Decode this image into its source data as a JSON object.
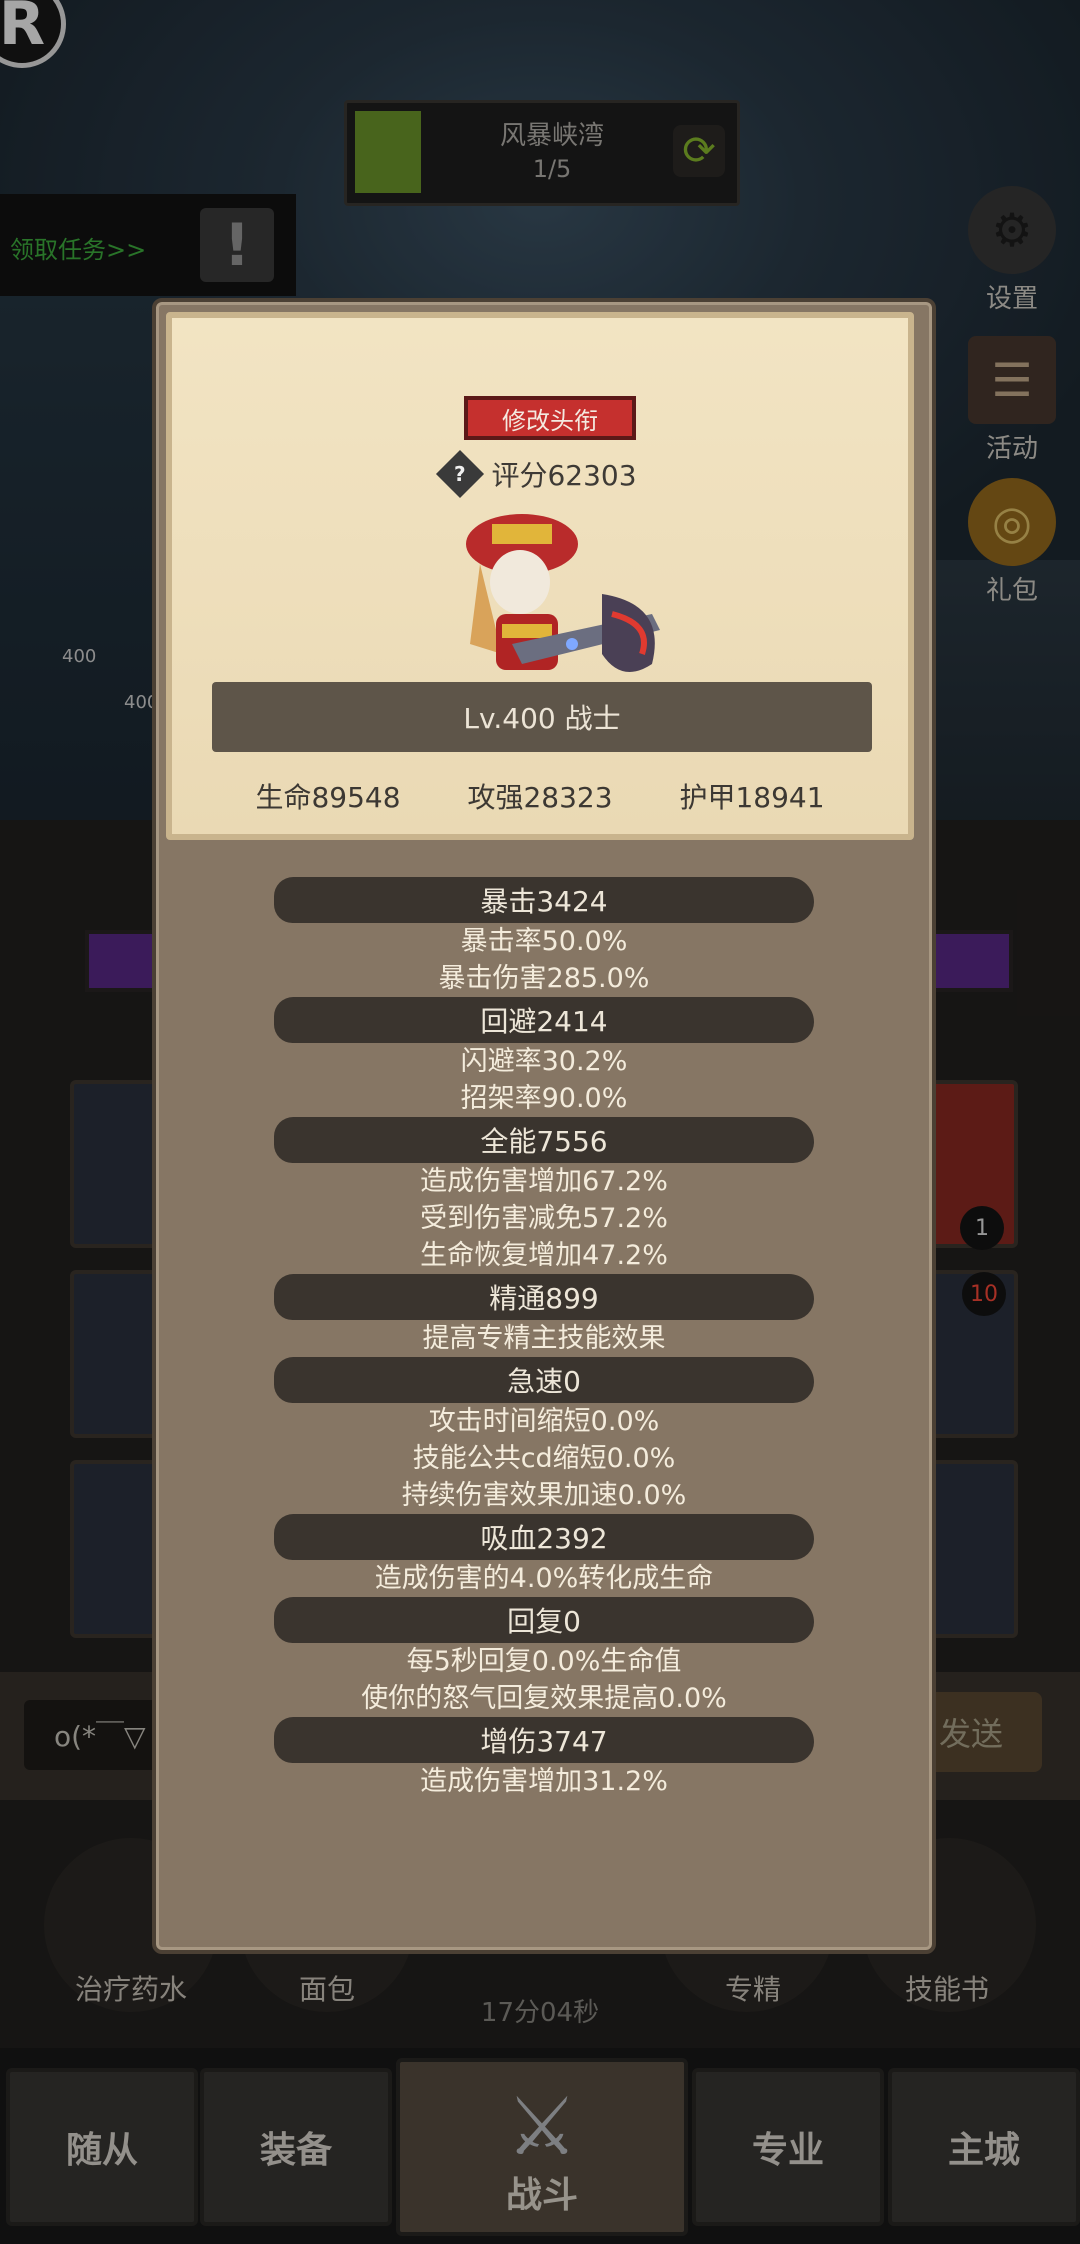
{
  "background": {
    "stage_name": "风暴峡湾",
    "stage_progress": "1/5",
    "task_text": "领取任务>>",
    "side_buttons": [
      {
        "label": "设置",
        "icon": "gear-icon"
      },
      {
        "label": "活动",
        "icon": "scroll-icon"
      },
      {
        "label": "礼包",
        "icon": "gift-icon"
      }
    ],
    "hp_labels": [
      "400",
      "400"
    ],
    "chat_input": "o(*￣▽",
    "send_label": "发送",
    "badges": [
      "1",
      "10"
    ],
    "skills": [
      "治疗药水",
      "面包",
      "专精",
      "技能书"
    ],
    "timer": "17分04秒",
    "nav_tabs": [
      "随从",
      "装备",
      "战斗",
      "专业",
      "主城"
    ]
  },
  "modal": {
    "edit_title_button": "修改头衔",
    "score": "评分62303",
    "level_class": "Lv.400 战士",
    "base_stats": [
      "生命89548",
      "攻强28323",
      "护甲18941"
    ],
    "stat_groups": [
      {
        "header": "暴击3424",
        "lines": [
          "暴击率50.0%",
          "暴击伤害285.0%"
        ]
      },
      {
        "header": "回避2414",
        "lines": [
          "闪避率30.2%",
          "招架率90.0%"
        ]
      },
      {
        "header": "全能7556",
        "lines": [
          "造成伤害增加67.2%",
          "受到伤害减免57.2%",
          "生命恢复增加47.2%"
        ]
      },
      {
        "header": "精通899",
        "lines": [
          "提高专精主技能效果"
        ]
      },
      {
        "header": "急速0",
        "lines": [
          "攻击时间缩短0.0%",
          "技能公共cd缩短0.0%",
          "持续伤害效果加速0.0%"
        ]
      },
      {
        "header": "吸血2392",
        "lines": [
          "造成伤害的4.0%转化成生命"
        ]
      },
      {
        "header": "回复0",
        "lines": [
          "每5秒回复0.0%生命值",
          "使你的怒气回复效果提高0.0%"
        ]
      },
      {
        "header": "增伤3747",
        "lines": [
          "造成伤害增加31.2%"
        ]
      }
    ]
  }
}
